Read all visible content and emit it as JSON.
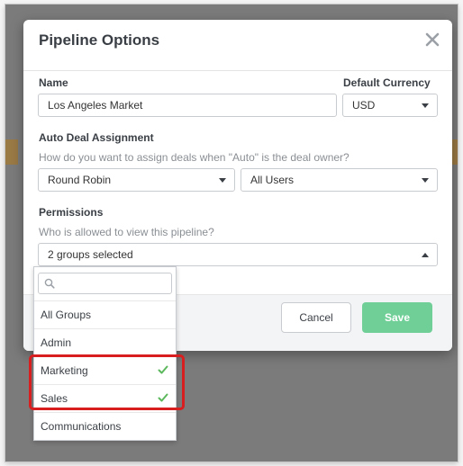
{
  "modal": {
    "title": "Pipeline Options",
    "name_label": "Name",
    "name_value": "Los Angeles Market",
    "currency_label": "Default Currency",
    "currency_value": "USD",
    "auto_label": "Auto Deal Assignment",
    "auto_question": "How do you want to assign deals when \"Auto\" is the deal owner?",
    "assign_method": "Round Robin",
    "assign_users": "All Users",
    "perm_label": "Permissions",
    "perm_question": "Who is allowed to view this pipeline?",
    "perm_value": "2 groups selected",
    "cancel_label": "Cancel",
    "save_label": "Save"
  },
  "dropdown": {
    "search_placeholder": "",
    "items": [
      {
        "label": "All Groups",
        "checked": false
      },
      {
        "label": "Admin",
        "checked": false
      },
      {
        "label": "Marketing",
        "checked": true
      },
      {
        "label": "Sales",
        "checked": true
      },
      {
        "label": "Communications",
        "checked": false
      }
    ]
  },
  "colors": {
    "accent_green": "#6fcf97",
    "check_green": "#5cb85c",
    "highlight_red": "#d81e1e",
    "overlay": "#7b7b7b"
  },
  "icons": {
    "close": "close-icon",
    "search": "search-icon",
    "caret": "chevron-down-icon",
    "check": "check-icon"
  }
}
